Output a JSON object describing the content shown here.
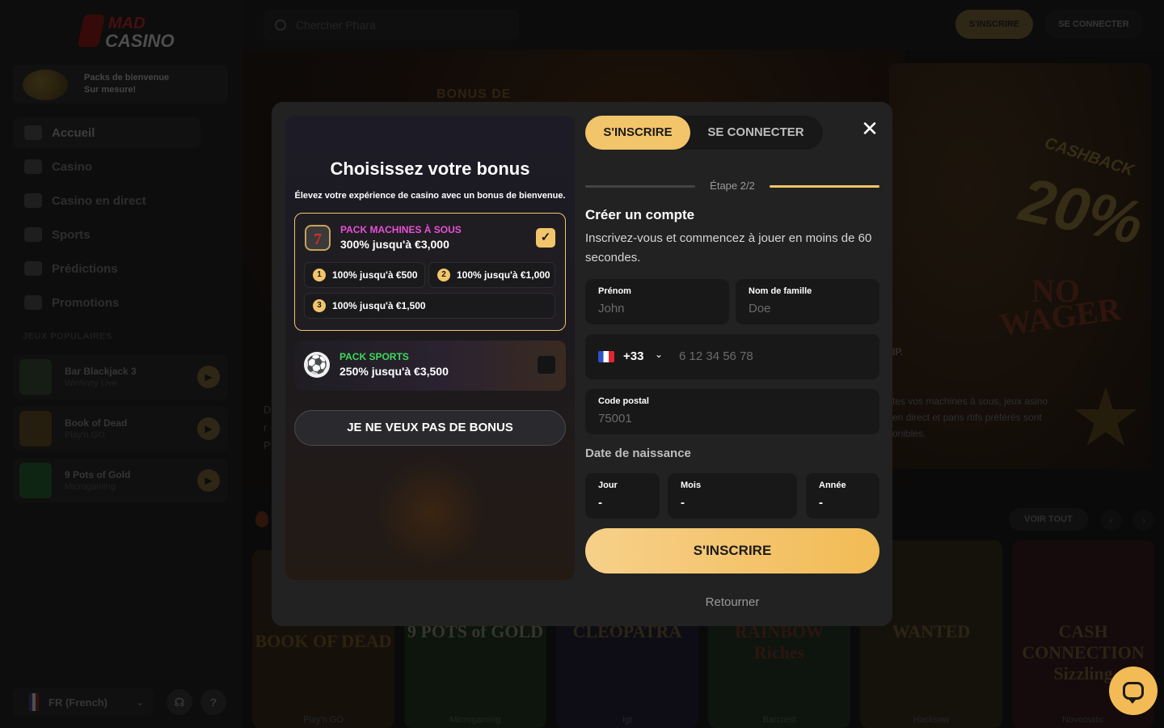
{
  "app": {
    "logo_top": "MAD",
    "logo_bottom": "CASINO"
  },
  "topbar": {
    "search_placeholder": "Chercher Phara",
    "register_label": "S'INSCRIRE",
    "login_label": "SE CONNECTER"
  },
  "sidebar": {
    "promo_line1": "Packs de bienvenue",
    "promo_line2": "Sur mesure!",
    "nav": [
      {
        "label": "Accueil",
        "icon": "home-icon"
      },
      {
        "label": "Casino",
        "icon": "slot-machine-icon"
      },
      {
        "label": "Casino en direct",
        "icon": "live-cards-icon"
      },
      {
        "label": "Sports",
        "icon": "football-icon"
      },
      {
        "label": "Prédictions",
        "icon": "predictions-icon"
      },
      {
        "label": "Promotions",
        "icon": "gift-icon"
      }
    ],
    "popular_label": "JEUX POPULAIRES",
    "popular_games": [
      {
        "name": "Bar Blackjack 3",
        "provider": "Winfinity Live"
      },
      {
        "name": "Book of Dead",
        "provider": "Play'n GO"
      },
      {
        "name": "9 Pots of Gold",
        "provider": "Microgaming"
      }
    ],
    "language": "FR (French)",
    "help_glyph": "?"
  },
  "hero": {
    "banner_text": "BONUS DE",
    "right_cashback": "CASHBACK",
    "right_percent": "20%",
    "right_no": "NO",
    "right_wager": "WAGER",
    "right_vip": "IP.",
    "right_text": "tes vos machines à sous, jeux asino en direct et paris rtifs préférés sont onibles.",
    "left_letters": "D\nr\nP"
  },
  "games_row": {
    "see_all": "VOIR TOUT",
    "tiles": [
      {
        "title": "BOOK OF DEAD",
        "provider": "Play'n GO",
        "bg": "#2a2214",
        "color": "#5a4520"
      },
      {
        "title": "9 POTS of GOLD",
        "provider": "Microgaming",
        "bg": "#1a2a18",
        "color": "#6a6a5a"
      },
      {
        "title": "CLEOPATRA",
        "provider": "Igt",
        "bg": "#1c1a2a",
        "color": "#5a4a2a"
      },
      {
        "title": "RAINBOW Riches",
        "provider": "Barcrest",
        "bg": "#1a2a1c",
        "color": "#5a2a20"
      },
      {
        "title": "WANTED",
        "provider": "Hacksaw",
        "bg": "#2a2418",
        "color": "#5a4a2a"
      },
      {
        "title": "CASH CONNECTION Sizzling",
        "provider": "Novomatic",
        "bg": "#2a1418",
        "color": "#5a4a2a"
      }
    ]
  },
  "bonus": {
    "title": "Choisissez votre bonus",
    "subtitle": "Élevez votre expérience de casino avec un bonus de bienvenue.",
    "slots_pack": {
      "label": "PACK MACHINES À SOUS",
      "value": "300% jusqu'à €3,000",
      "icon_glyph": "7",
      "check_glyph": "✓",
      "selected": true,
      "tiers": [
        {
          "num": "1",
          "label": "100% jusqu'à €500"
        },
        {
          "num": "2",
          "label": "100% jusqu'à €1,000"
        },
        {
          "num": "3",
          "label": "100% jusqu'à €1,500"
        }
      ]
    },
    "sports_pack": {
      "label": "PACK SPORTS",
      "value": "250% jusqu'à €3,500",
      "icon_glyph": "⚽",
      "selected": false
    },
    "no_bonus_label": "JE NE VEUX PAS DE BONUS"
  },
  "form": {
    "tab_register": "S'INSCRIRE",
    "tab_login": "SE CONNECTER",
    "close_glyph": "✕",
    "step": "Étape 2/2",
    "title": "Créer un compte",
    "description": "Inscrivez-vous et commencez à jouer en moins de 60 secondes.",
    "first_name": {
      "label": "Prénom",
      "placeholder": "John"
    },
    "last_name": {
      "label": "Nom de famille",
      "placeholder": "Doe"
    },
    "phone": {
      "country_code": "+33",
      "placeholder": "6 12 34 56 78"
    },
    "postal_code": {
      "label": "Code postal",
      "placeholder": "75001"
    },
    "dob_label": "Date de naissance",
    "day": {
      "label": "Jour",
      "value": "-"
    },
    "month": {
      "label": "Mois",
      "value": "-"
    },
    "year": {
      "label": "Année",
      "value": "-"
    },
    "submit_label": "S'INSCRIRE",
    "back_label": "Retourner"
  },
  "colors": {
    "accent": "#f2c56a",
    "slots_label": "#e94fd6",
    "sports_label": "#3fd85a",
    "modal_bg": "#222222"
  }
}
